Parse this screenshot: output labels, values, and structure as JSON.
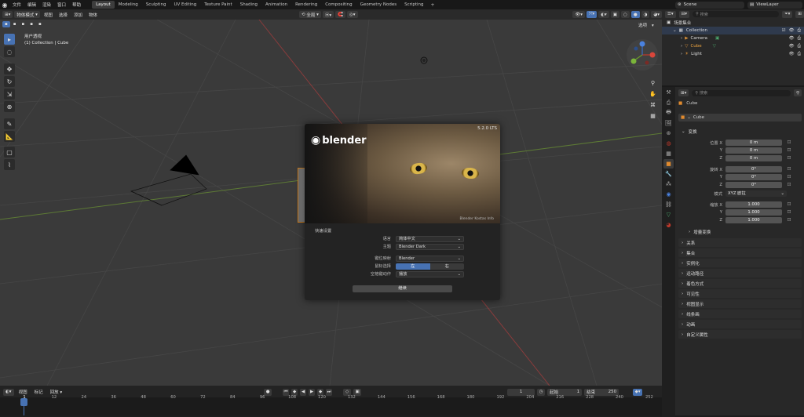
{
  "menubar": {
    "items": [
      "文件",
      "编辑",
      "渲染",
      "窗口",
      "帮助"
    ],
    "workspaces": [
      "Layout",
      "Modeling",
      "Sculpting",
      "UV Editing",
      "Texture Paint",
      "Shading",
      "Animation",
      "Rendering",
      "Compositing",
      "Geometry Nodes",
      "Scripting"
    ],
    "active_workspace": "Layout",
    "add_tab": "+",
    "scene_label": "Scene",
    "viewlayer_label": "ViewLayer"
  },
  "viewport": {
    "mode": "物体模式",
    "menus": [
      "视图",
      "选择",
      "添加",
      "物体"
    ],
    "transform_orientation": "全局",
    "options_label": "选项",
    "view_name": "用户透视",
    "collection_info": "(1) Collection | Cube",
    "grid_color": "#464646",
    "x_axis_color": "#8a3c3c",
    "y_axis_color": "#5d7a35"
  },
  "splash": {
    "version": "5.2.0 LTS",
    "logo_text": "blender",
    "credit": "Blender Kostas Info",
    "section_title": "快速设置",
    "rows": [
      {
        "label": "语言",
        "value": "简体中文"
      },
      {
        "label": "主题",
        "value": "Blender Dark"
      },
      {
        "label": "键位映射",
        "value": "Blender"
      },
      {
        "label": "空格键动作",
        "value": "播放"
      }
    ],
    "mouse_select_label": "鼠标选择",
    "mouse_left": "左",
    "mouse_right": "右",
    "continue_label": "继续",
    "accent": "#4772b3"
  },
  "outliner": {
    "search_placeholder": "搜索",
    "root": "场景集合",
    "collection": "Collection",
    "items": [
      "Camera",
      "Cube",
      "Light"
    ]
  },
  "properties": {
    "search_placeholder": "搜索",
    "object_name": "Cube",
    "data_name": "Cube",
    "transform_panel": "变换",
    "location_label": "位置 X",
    "rotation_label": "旋转 X",
    "mode_label": "模式",
    "mode_value": "XYZ 欧拉",
    "scale_label": "缩放 X",
    "y_label": "Y",
    "z_label": "Z",
    "location": [
      "0 m",
      "0 m",
      "0 m"
    ],
    "rotation": [
      "0°",
      "0°",
      "0°"
    ],
    "scale": [
      "1.000",
      "1.000",
      "1.000"
    ],
    "delta_transform": "增量变换",
    "panels": [
      "关系",
      "集合",
      "实例化",
      "运动路径",
      "着色方式",
      "可见性",
      "视图显示",
      "线条画",
      "动画",
      "自定义属性"
    ]
  },
  "timeline": {
    "menus": [
      "视图",
      "标记",
      "回放"
    ],
    "current_frame": "1",
    "start_label": "起始",
    "start_value": "1",
    "end_label": "结束",
    "end_value": "250",
    "ruler": [
      "1",
      "12",
      "24",
      "36",
      "48",
      "60",
      "72",
      "84",
      "96",
      "108",
      "120",
      "132",
      "144",
      "156",
      "168",
      "180",
      "192",
      "204",
      "216",
      "228",
      "240",
      "252"
    ]
  }
}
